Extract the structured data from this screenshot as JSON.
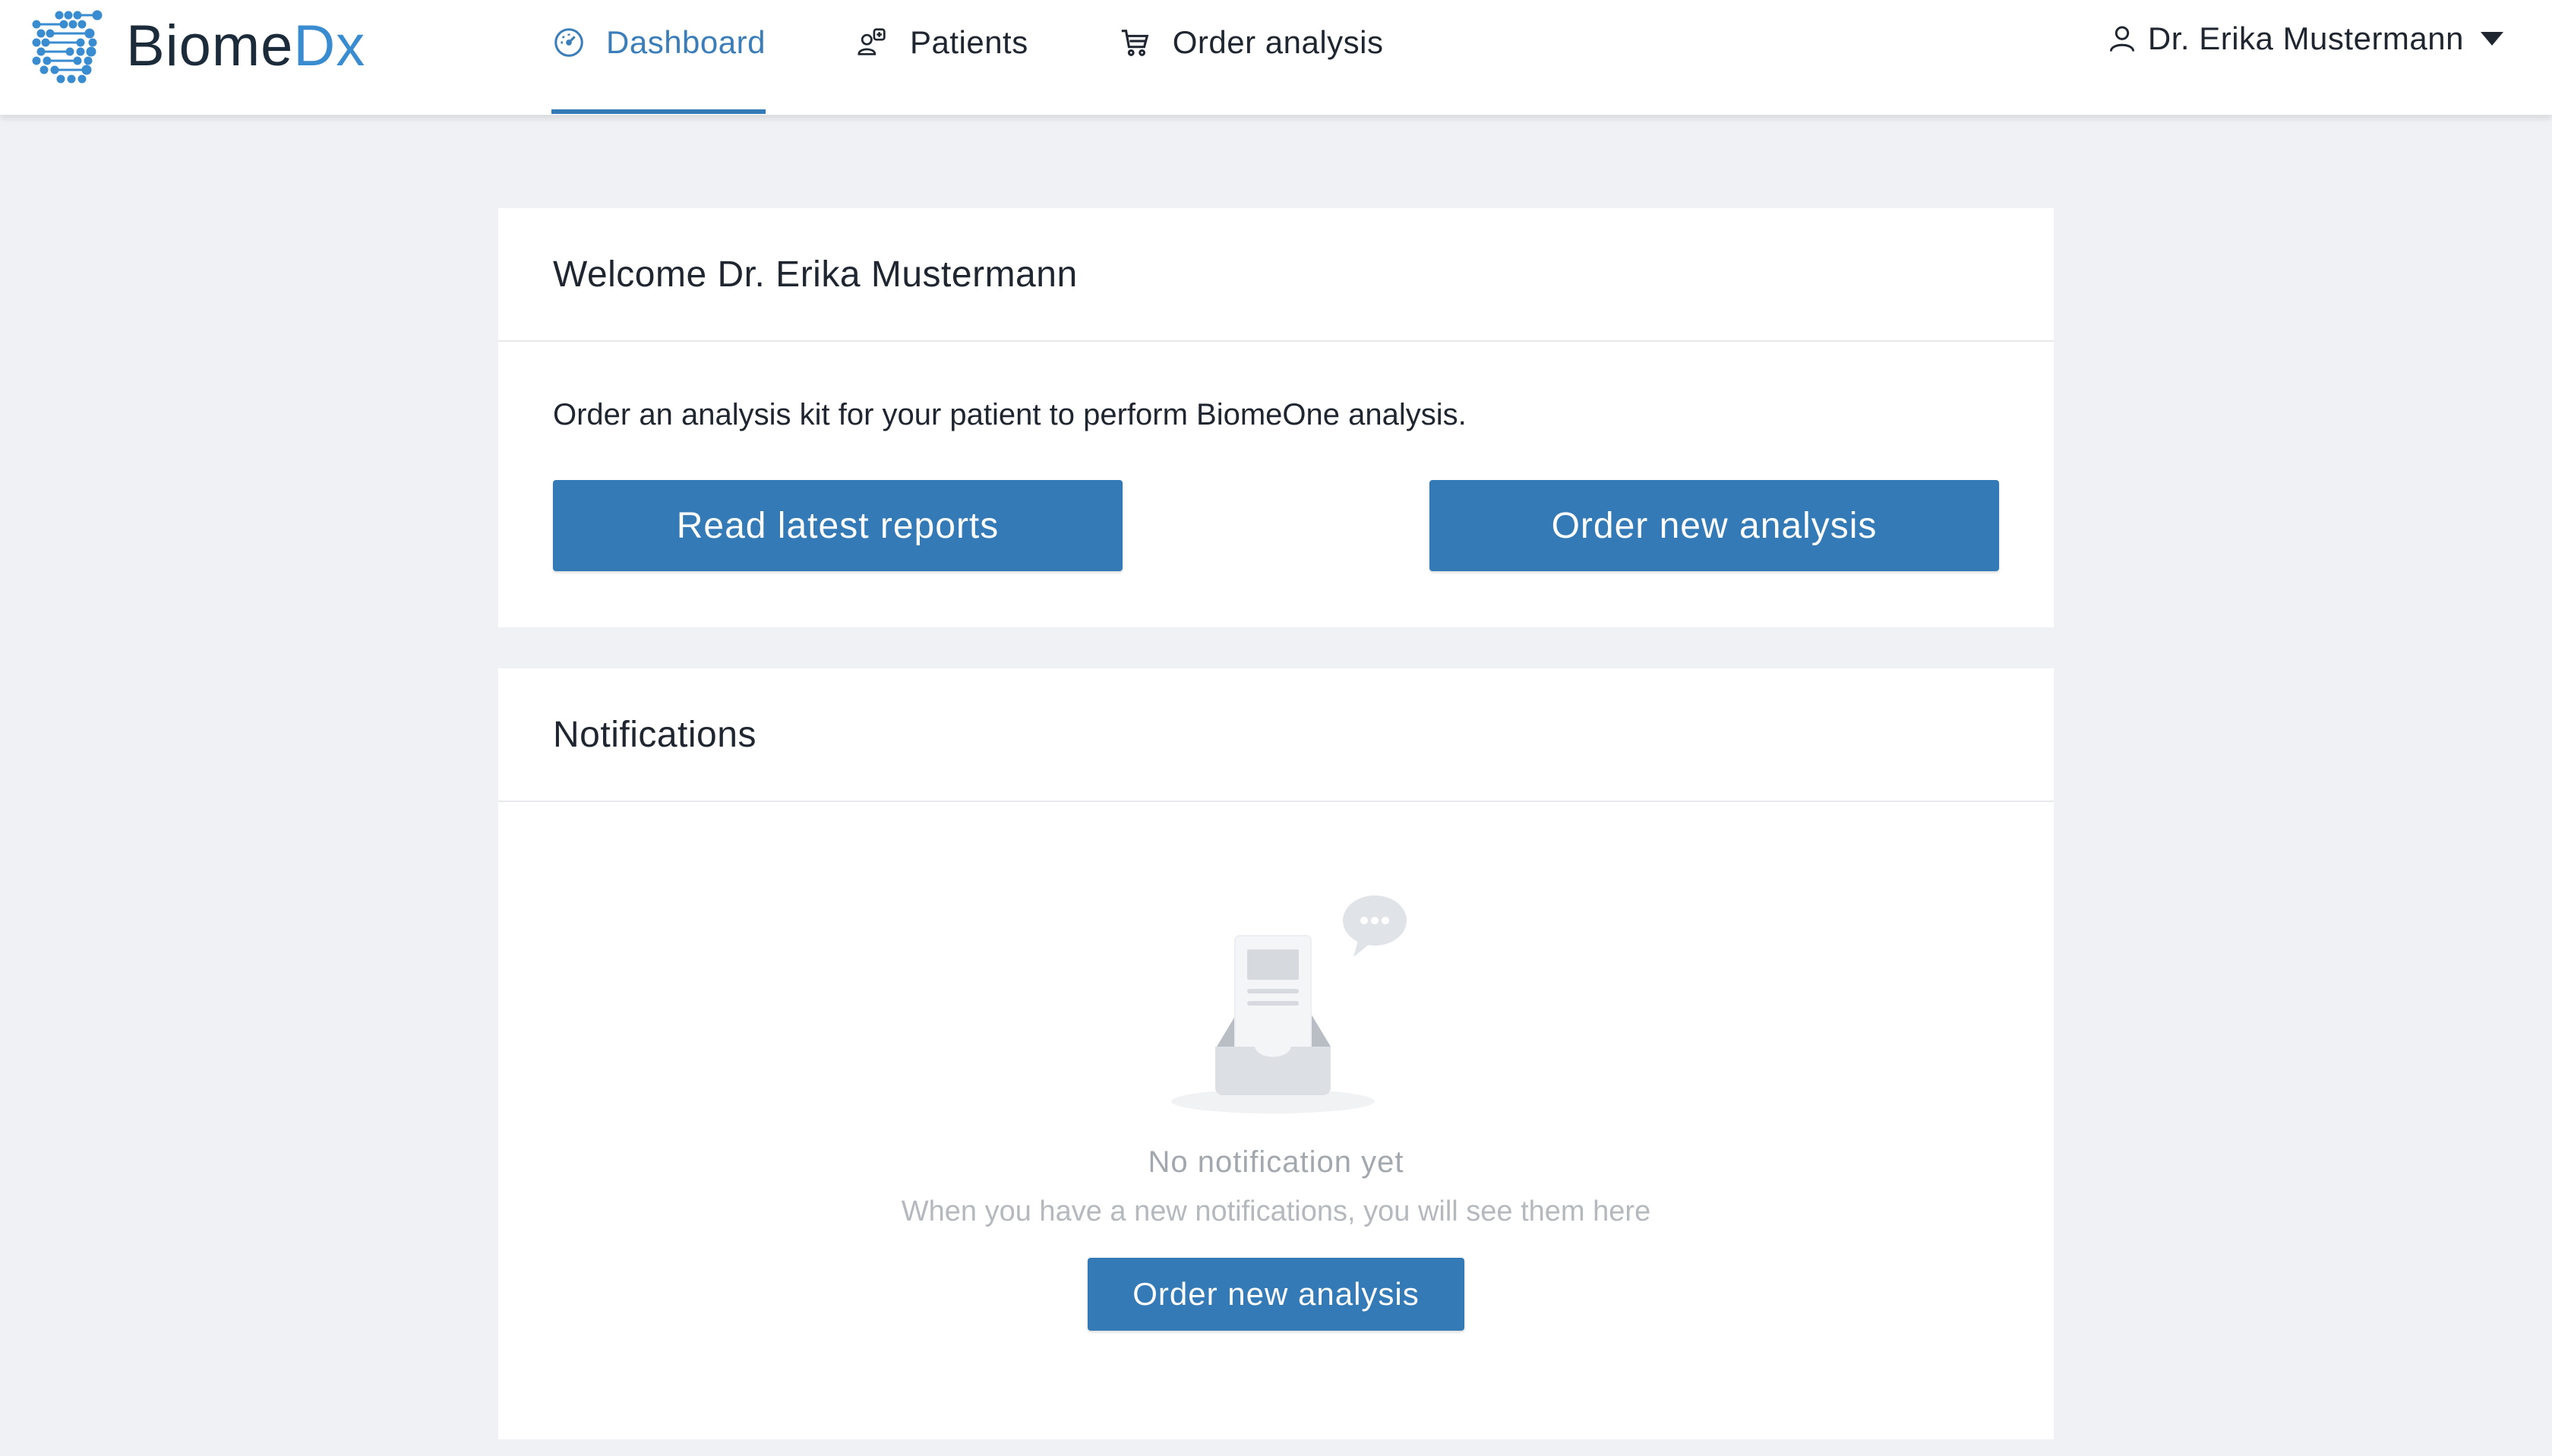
{
  "brand": {
    "name_part1": "Biome",
    "name_part2": "Dx",
    "accent_color": "#3a8cd1",
    "text_color": "#1c2b3a"
  },
  "nav": {
    "items": [
      {
        "label": "Dashboard",
        "icon": "dashboard-gauge-icon",
        "active": true
      },
      {
        "label": "Patients",
        "icon": "patients-icon",
        "active": false
      },
      {
        "label": "Order analysis",
        "icon": "cart-icon",
        "active": false
      }
    ],
    "active_color": "#337ab7"
  },
  "user": {
    "name": "Dr. Erika Mustermann",
    "icon": "user-icon"
  },
  "welcome": {
    "title": "Welcome Dr. Erika Mustermann",
    "message": "Order an analysis kit for your patient to perform BiomeOne analysis.",
    "read_reports_label": "Read latest reports",
    "order_new_label": "Order new analysis"
  },
  "notifications": {
    "title": "Notifications",
    "empty_title": "No notification yet",
    "empty_message": "When you have a new notifications, you will see them here",
    "order_new_label": "Order new analysis",
    "illustration": "empty-inbox-icon"
  },
  "colors": {
    "primary_button": "#337ab7",
    "page_background": "#f0f1f4"
  }
}
